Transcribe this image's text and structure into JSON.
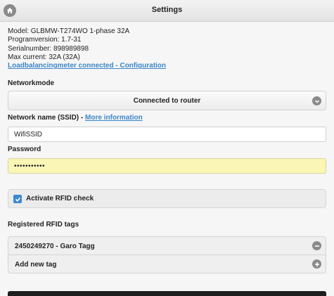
{
  "header": {
    "title": "Settings"
  },
  "info": {
    "model": "Model: GLBMW-T274WO 1-phase 32A",
    "program_version": "Programversion: 1.7-31",
    "serial_number": "Serialnumber: 898989898",
    "max_current": "Max current: 32A (32A)",
    "loadbalancing_link": "Loadbalancingmeter connected - Configuration"
  },
  "networkmode": {
    "label": "Networkmode",
    "selected": "Connected to router"
  },
  "ssid": {
    "label": "Network name (SSID) - ",
    "more_info_link": "More information",
    "value": "WifiSSID"
  },
  "password": {
    "label": "Password",
    "value": "•••••••••••"
  },
  "rfid_check": {
    "label": "Activate RFID check",
    "checked": true
  },
  "rfid_tags": {
    "label": "Registered RFID tags",
    "items": [
      {
        "label": "2450249270 - Garo Tagg"
      }
    ],
    "add_label": "Add new tag"
  },
  "colors": {
    "link": "#3b86c9",
    "checkbox": "#3d88cf",
    "password_bg": "#f9f6b6"
  }
}
